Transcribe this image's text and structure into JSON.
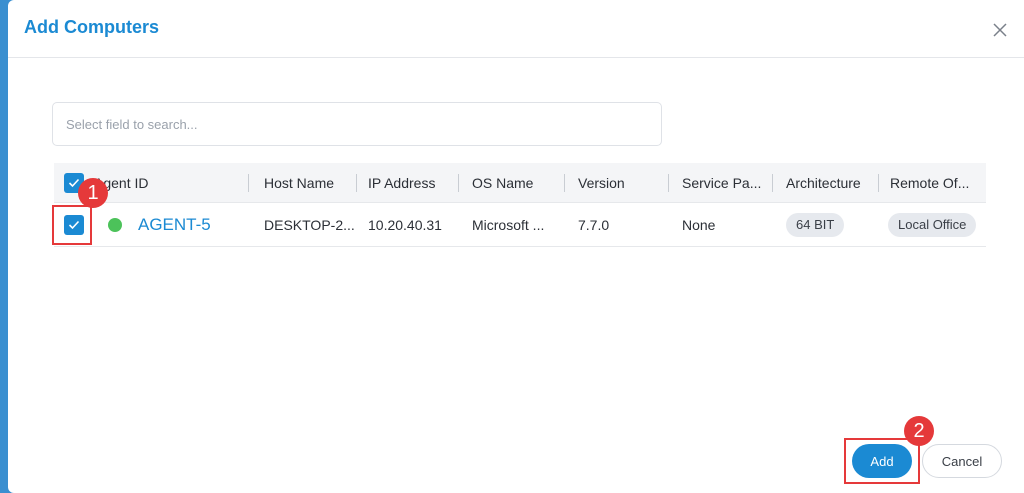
{
  "dialog": {
    "title": "Add Computers",
    "close_icon": "close-icon"
  },
  "search": {
    "placeholder": "Select field to search..."
  },
  "table": {
    "columns": [
      "Agent ID",
      "Host Name",
      "IP Address",
      "OS Name",
      "Version",
      "Service Pa...",
      "Architecture",
      "Remote Of..."
    ],
    "header_checked": true,
    "rows": [
      {
        "checked": true,
        "status": "online",
        "agent_id": "AGENT-5",
        "host_name": "DESKTOP-2...",
        "ip_address": "10.20.40.31",
        "os_name": "Microsoft ...",
        "version": "7.7.0",
        "service_pack": "None",
        "architecture": "64 BIT",
        "remote_office": "Local Office"
      }
    ]
  },
  "annotations": {
    "step1": "1",
    "step2": "2"
  },
  "footer": {
    "add_label": "Add",
    "cancel_label": "Cancel"
  },
  "colors": {
    "accent": "#1b8ad3",
    "status_online": "#4cc25a",
    "annotation": "#e5393a"
  }
}
